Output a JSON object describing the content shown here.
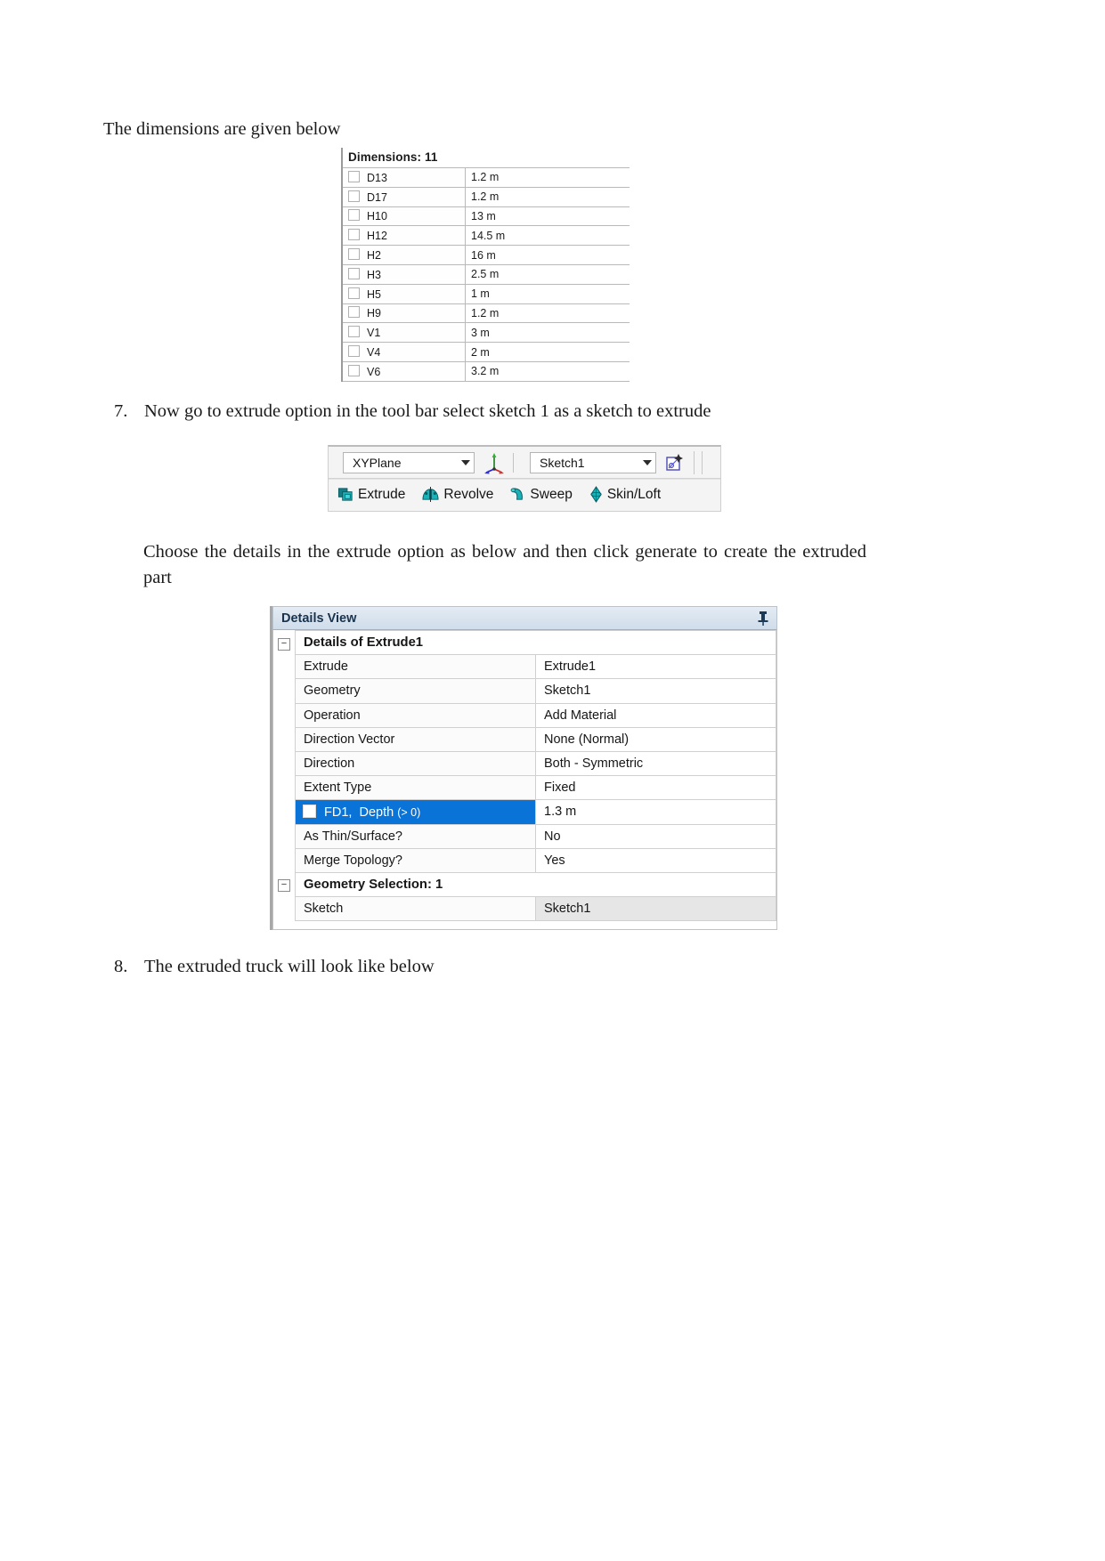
{
  "document": {
    "intro_line": "The dimensions are given below",
    "steps": [
      {
        "number": "7.",
        "text": "Now go to extrude option in the tool bar select sketch 1 as a sketch to extrude"
      },
      {
        "number": "8.",
        "text": "The extruded truck will look like below"
      }
    ],
    "paragraph_choose": "Choose the details in the extrude option as below and then click generate to create the extruded part"
  },
  "dimensions_panel": {
    "header": "Dimensions: 11",
    "rows": [
      {
        "name": "D13",
        "value": "1.2 m"
      },
      {
        "name": "D17",
        "value": "1.2 m"
      },
      {
        "name": "H10",
        "value": "13 m"
      },
      {
        "name": "H12",
        "value": "14.5 m"
      },
      {
        "name": "H2",
        "value": "16 m"
      },
      {
        "name": "H3",
        "value": "2.5 m"
      },
      {
        "name": "H5",
        "value": "1 m"
      },
      {
        "name": "H9",
        "value": "1.2 m"
      },
      {
        "name": "V1",
        "value": "3 m"
      },
      {
        "name": "V4",
        "value": "2 m"
      },
      {
        "name": "V6",
        "value": "3.2 m"
      }
    ]
  },
  "toolbar": {
    "plane_combo_value": "XYPlane",
    "sketch_combo_value": "Sketch1",
    "axis_icon_name": "axis-triad-icon",
    "new_sketch_icon_name": "new-sketch-icon",
    "buttons": [
      {
        "label": "Extrude",
        "icon": "extrude-icon"
      },
      {
        "label": "Revolve",
        "icon": "revolve-icon"
      },
      {
        "label": "Sweep",
        "icon": "sweep-icon"
      },
      {
        "label": "Skin/Loft",
        "icon": "skin-loft-icon"
      }
    ]
  },
  "details_view": {
    "title": "Details View",
    "pin_icon": "pin-icon",
    "section_details": "Details of Extrude1",
    "section_geometry_selection": "Geometry Selection: 1",
    "rows": [
      {
        "label": "Extrude",
        "value": "Extrude1"
      },
      {
        "label": "Geometry",
        "value": "Sketch1"
      },
      {
        "label": "Operation",
        "value": "Add Material"
      },
      {
        "label": "Direction Vector",
        "value": "None (Normal)"
      },
      {
        "label": "Direction",
        "value": "Both - Symmetric"
      },
      {
        "label": "Extent Type",
        "value": "Fixed"
      }
    ],
    "highlighted_row": {
      "label_main": "FD1,",
      "label_sub": "Depth",
      "label_suffix": "(> 0)",
      "value": "1.3 m"
    },
    "rows_after": [
      {
        "label": "As Thin/Surface?",
        "value": "No"
      },
      {
        "label": "Merge Topology?",
        "value": "Yes"
      }
    ],
    "geometry_row": {
      "label": "Sketch",
      "value": "Sketch1"
    }
  },
  "colors": {
    "highlight_blue": "#0a73d8",
    "teal_icon": "#0f9b9b",
    "title_bar": "#cfdcea"
  }
}
